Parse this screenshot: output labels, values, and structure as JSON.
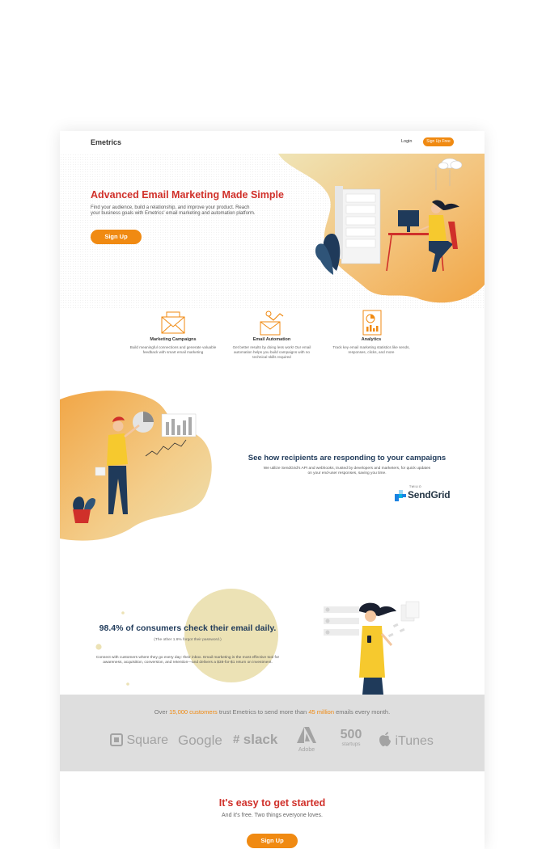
{
  "nav": {
    "logo": "Emetrics",
    "login": "Login",
    "signup": "Sign Up Free"
  },
  "hero": {
    "title": "Advanced Email Marketing Made Simple",
    "subtitle": "Find your audience, build a relationship, and improve your product. Reach your business goals with Emetrics' email marketing and automation platform.",
    "cta": "Sign Up"
  },
  "features": [
    {
      "icon": "envelope-icon",
      "title": "Marketing Campaigns",
      "desc": "Build meaningful connections and generate valuable feedback with smart email marketing"
    },
    {
      "icon": "robot-arm-icon",
      "title": "Email Automation",
      "desc": "Get better results by doing less work! Our email automation helps you build campaigns with no technical skills required"
    },
    {
      "icon": "report-chart-icon",
      "title": "Analytics",
      "desc": "Track key email marketing statistics like sends, responses, clicks, and more"
    }
  ],
  "section2": {
    "title": "See how recipients are responding to your campaigns",
    "desc": "We utilize SendGrid's API and webhooks, trusted by developers and marketers, for quick updates on your end-user responses, saving you time.",
    "partner_tag": "TWILIO",
    "partner_name": "SendGrid"
  },
  "section3": {
    "title": "98.4% of consumers check their email daily.",
    "note": "(The other 1.6% forgot their password.)",
    "desc": "Connect with customers where they go every day: their inbox. Email marketing is the most effective tool for awareness, acquisition, conversion, and retention—and delivers a $38-for-$1 return on investment."
  },
  "trust": {
    "prefix": "Over ",
    "customers": "15,000 customers",
    "middle": " trust Emetrics to send more than ",
    "emails": "45 million",
    "suffix": " emails every month.",
    "logos": {
      "square": "Square",
      "google": "Google",
      "slack": "slack",
      "adobe": "Adobe",
      "startups_num": "500",
      "startups_word": "startups",
      "itunes": "iTunes"
    }
  },
  "cta": {
    "title": "It's easy to get started",
    "subtitle": "And it's free. Two things everyone loves.",
    "button": "Sign Up"
  },
  "colors": {
    "accent": "#f08a12",
    "headline_red": "#d0302a",
    "navy": "#1f3a5a",
    "trust_bg": "#dedede"
  }
}
